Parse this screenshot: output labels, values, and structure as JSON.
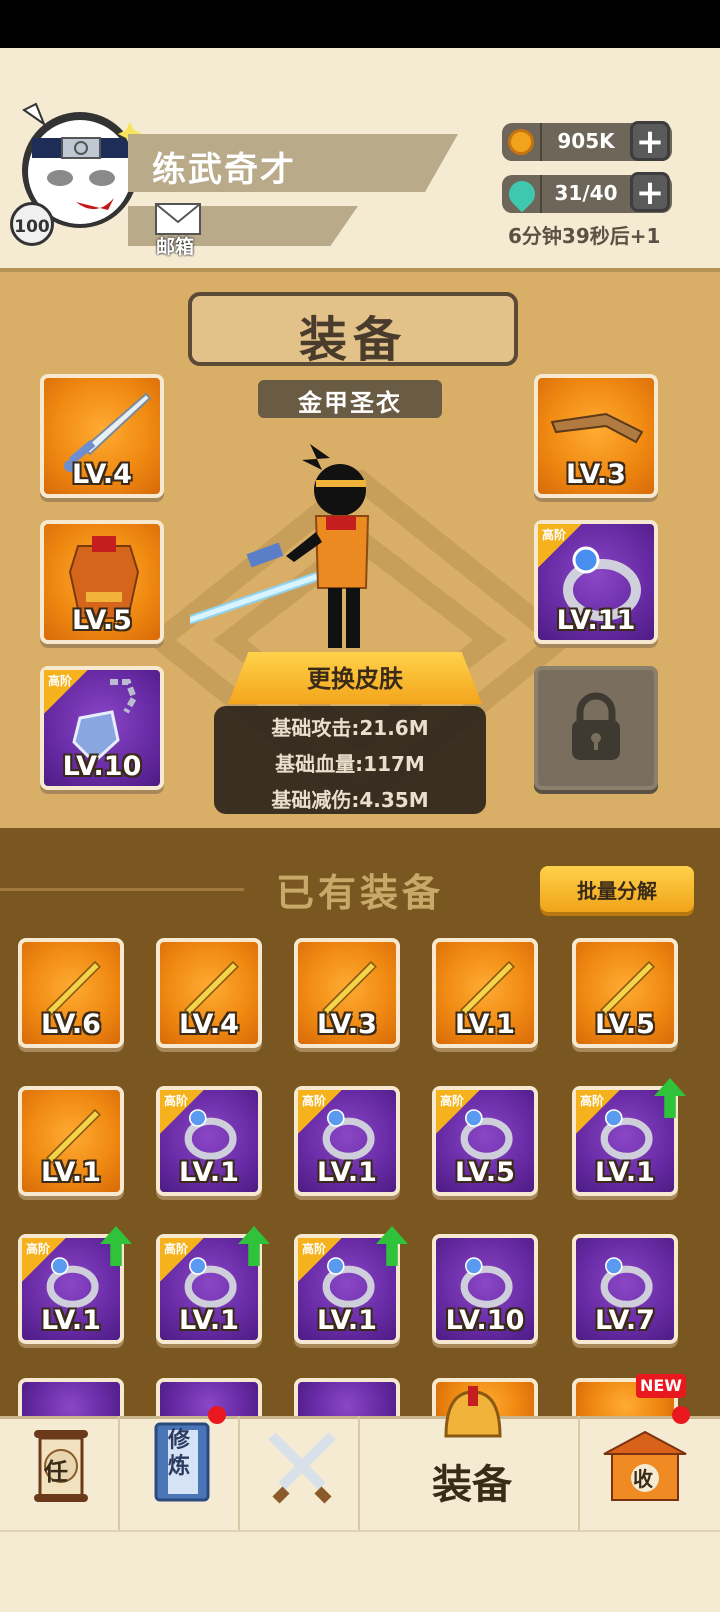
{
  "player": {
    "name": "练武奇才",
    "level": "100",
    "mail_label": "邮箱"
  },
  "resources": {
    "coins": "905K",
    "energy": "31/40",
    "timer": "6分钟39秒后+1",
    "plus": "+",
    "coin_color": "#f2a21c",
    "energy_color": "#3fc7b0"
  },
  "equipment": {
    "title": "装备",
    "skin_name": "金甲圣衣",
    "change_skin_button": "更换皮肤",
    "stats": [
      "基础攻击:21.6M",
      "基础血量:117M",
      "基础减伤:4.35M"
    ],
    "slots": [
      {
        "name": "sword",
        "level": "LV.4",
        "color": "orange",
        "tier": ""
      },
      {
        "name": "armor",
        "level": "LV.5",
        "color": "orange",
        "tier": ""
      },
      {
        "name": "amulet",
        "level": "LV.10",
        "color": "purple",
        "tier": "高阶"
      },
      {
        "name": "headband",
        "level": "LV.3",
        "color": "orange",
        "tier": ""
      },
      {
        "name": "ring",
        "level": "LV.11",
        "color": "purple",
        "tier": "高阶"
      },
      {
        "name": "locked",
        "level": "",
        "color": "locked",
        "tier": ""
      }
    ]
  },
  "owned": {
    "title": "已有装备",
    "bulk_button": "批量分解",
    "items": [
      {
        "name": "broadsword",
        "level": "LV.6",
        "color": "orange",
        "tier": "",
        "upgrade": false
      },
      {
        "name": "mace",
        "level": "LV.4",
        "color": "orange",
        "tier": "",
        "upgrade": false
      },
      {
        "name": "spear",
        "level": "LV.3",
        "color": "orange",
        "tier": "",
        "upgrade": false
      },
      {
        "name": "staff",
        "level": "LV.1",
        "color": "orange",
        "tier": "",
        "upgrade": false
      },
      {
        "name": "straw-hat",
        "level": "LV.5",
        "color": "orange",
        "tier": "",
        "upgrade": false
      },
      {
        "name": "robe",
        "level": "LV.1",
        "color": "orange",
        "tier": "",
        "upgrade": false
      },
      {
        "name": "saber",
        "level": "LV.1",
        "color": "purple",
        "tier": "高阶",
        "upgrade": false
      },
      {
        "name": "gauntlet",
        "level": "LV.1",
        "color": "purple",
        "tier": "高阶",
        "upgrade": false
      },
      {
        "name": "amulet",
        "level": "LV.5",
        "color": "purple",
        "tier": "高阶",
        "upgrade": false
      },
      {
        "name": "gold-ring",
        "level": "LV.1",
        "color": "purple",
        "tier": "高阶",
        "upgrade": true
      },
      {
        "name": "bronze-amulet",
        "level": "LV.1",
        "color": "purple",
        "tier": "高阶",
        "upgrade": true
      },
      {
        "name": "blue-ring",
        "level": "LV.1",
        "color": "purple",
        "tier": "高阶",
        "upgrade": true
      },
      {
        "name": "blue-amulet",
        "level": "LV.1",
        "color": "purple",
        "tier": "高阶",
        "upgrade": true
      },
      {
        "name": "bronze-amulet-2",
        "level": "LV.10",
        "color": "purple",
        "tier": "",
        "upgrade": false
      },
      {
        "name": "jade-ring",
        "level": "LV.7",
        "color": "purple",
        "tier": "",
        "upgrade": false
      }
    ]
  },
  "nav": {
    "tasks": "任",
    "training": "修炼",
    "battle_icon": "crossed-swords",
    "equipment": "装备",
    "collect": "收",
    "new_badge": "NEW"
  }
}
